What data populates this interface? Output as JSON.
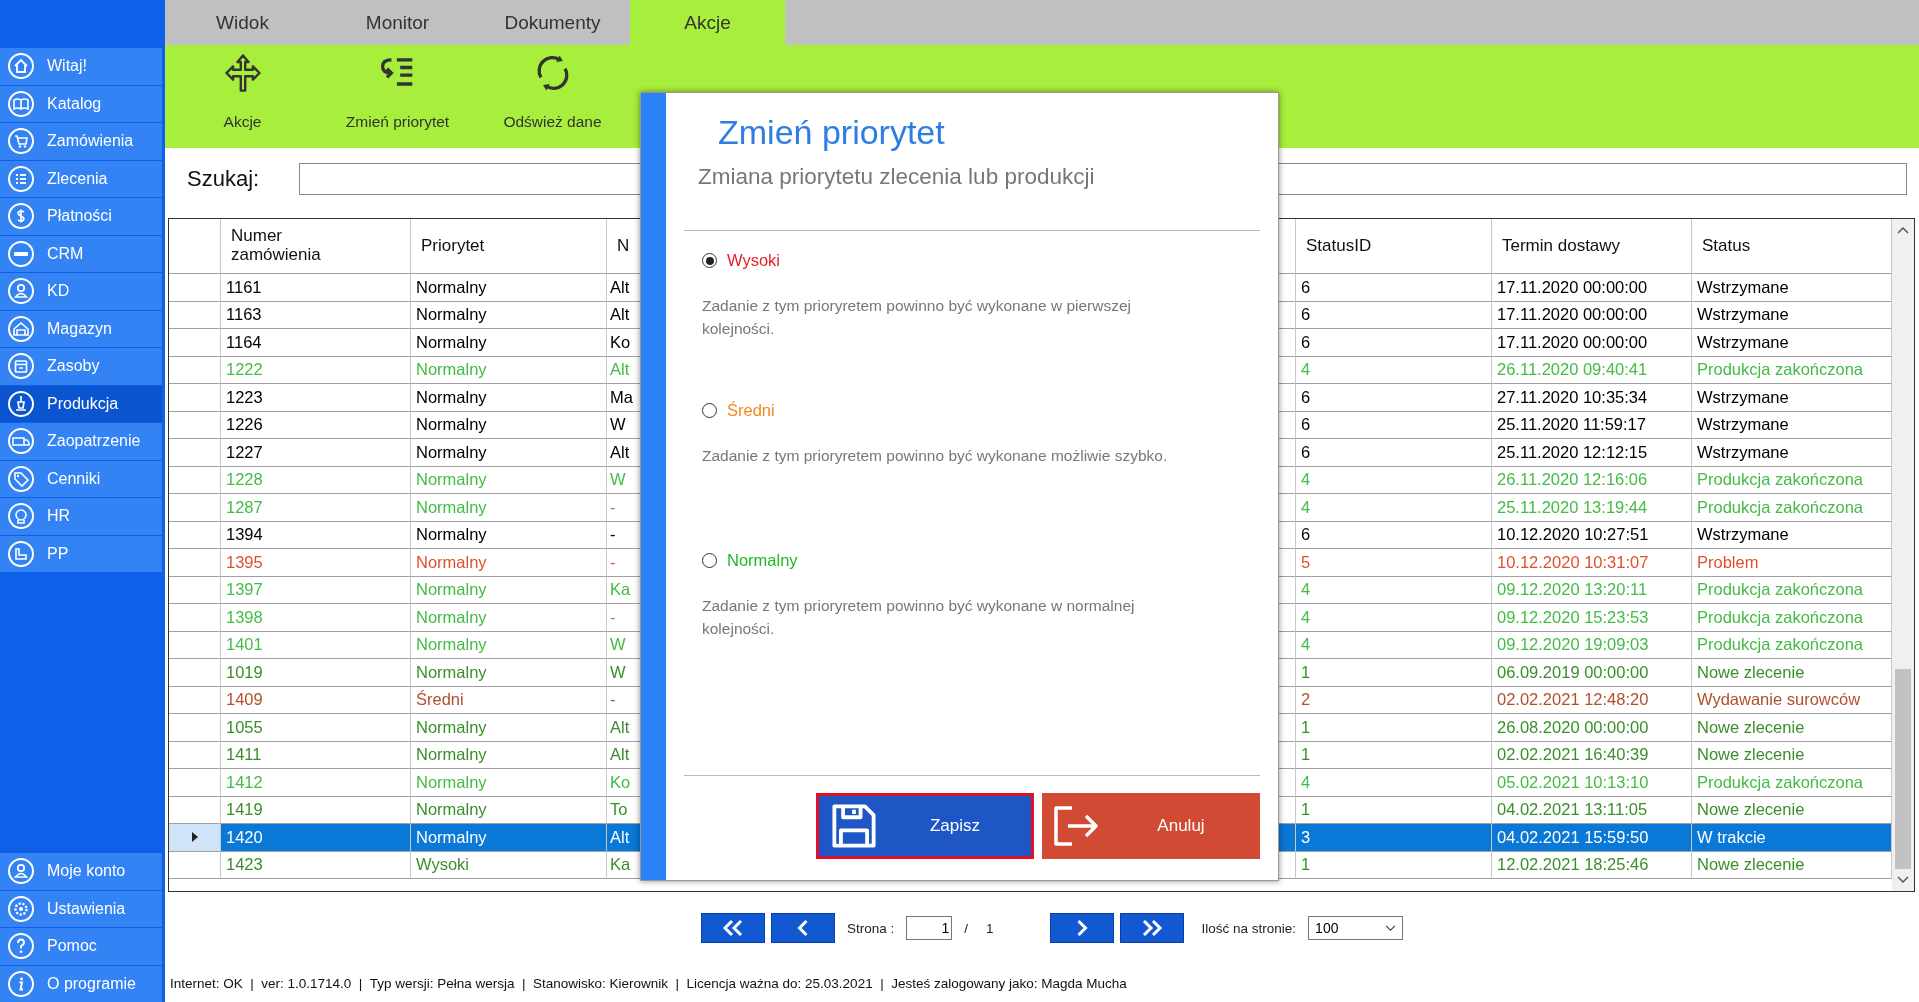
{
  "sidebar": {
    "items": [
      {
        "label": "Witaj!",
        "selected": false
      },
      {
        "label": "Katalog",
        "selected": false
      },
      {
        "label": "Zamówienia",
        "selected": false
      },
      {
        "label": "Zlecenia",
        "selected": false
      },
      {
        "label": "Płatności",
        "selected": false
      },
      {
        "label": "CRM",
        "selected": false
      },
      {
        "label": "KD",
        "selected": false
      },
      {
        "label": "Magazyn",
        "selected": false
      },
      {
        "label": "Zasoby",
        "selected": false
      },
      {
        "label": "Produkcja",
        "selected": true
      },
      {
        "label": "Zaopatrzenie",
        "selected": false
      },
      {
        "label": "Cenniki",
        "selected": false
      },
      {
        "label": "HR",
        "selected": false
      },
      {
        "label": "PP",
        "selected": false
      }
    ],
    "bottom_items": [
      {
        "label": "Moje konto",
        "selected": false
      },
      {
        "label": "Ustawienia",
        "selected": false
      },
      {
        "label": "Pomoc",
        "selected": false
      },
      {
        "label": "O programie",
        "selected": false
      }
    ]
  },
  "tabs": [
    {
      "label": "Widok",
      "selected": false
    },
    {
      "label": "Monitor",
      "selected": false
    },
    {
      "label": "Dokumenty",
      "selected": false
    },
    {
      "label": "Akcje",
      "selected": true
    }
  ],
  "toolbar": {
    "buttons": [
      {
        "label": "Akcje"
      },
      {
        "label": "Zmień priorytet"
      },
      {
        "label": "Odśwież dane"
      }
    ]
  },
  "search": {
    "label": "Szukaj:"
  },
  "table": {
    "columns": [
      "Numer zamówienia",
      "Priorytet",
      "N",
      "StatusID",
      "Termin dostawy",
      "Status"
    ],
    "rows": [
      {
        "cells": [
          "1161",
          "Normalny",
          "Alt",
          "6",
          "17.11.2020 00:00:00",
          "Wstrzymane"
        ],
        "color": "#000000",
        "selected": false
      },
      {
        "cells": [
          "1163",
          "Normalny",
          "Alt",
          "6",
          "17.11.2020 00:00:00",
          "Wstrzymane"
        ],
        "color": "#000000",
        "selected": false
      },
      {
        "cells": [
          "1164",
          "Normalny",
          "Ko",
          "6",
          "17.11.2020 00:00:00",
          "Wstrzymane"
        ],
        "color": "#000000",
        "selected": false
      },
      {
        "cells": [
          "1222",
          "Normalny",
          "Alt",
          "4",
          "26.11.2020 09:40:41",
          "Produkcja zakończona"
        ],
        "color": "#44bb44",
        "selected": false
      },
      {
        "cells": [
          "1223",
          "Normalny",
          "Ma",
          "6",
          "27.11.2020 10:35:34",
          "Wstrzymane"
        ],
        "color": "#000000",
        "selected": false
      },
      {
        "cells": [
          "1226",
          "Normalny",
          "W",
          "6",
          "25.11.2020 11:59:17",
          "Wstrzymane"
        ],
        "color": "#000000",
        "selected": false
      },
      {
        "cells": [
          "1227",
          "Normalny",
          "Alt",
          "6",
          "25.11.2020 12:12:15",
          "Wstrzymane"
        ],
        "color": "#000000",
        "selected": false
      },
      {
        "cells": [
          "1228",
          "Normalny",
          "W",
          "4",
          "26.11.2020 12:16:06",
          "Produkcja zakończona"
        ],
        "color": "#44bb44",
        "selected": false
      },
      {
        "cells": [
          "1287",
          "Normalny",
          "-",
          "4",
          "25.11.2020 13:19:44",
          "Produkcja zakończona"
        ],
        "color": "#44bb44",
        "selected": false
      },
      {
        "cells": [
          "1394",
          "Normalny",
          "-",
          "6",
          "10.12.2020 10:27:51",
          "Wstrzymane"
        ],
        "color": "#000000",
        "selected": false
      },
      {
        "cells": [
          "1395",
          "Normalny",
          "-",
          "5",
          "10.12.2020 10:31:07",
          "Problem"
        ],
        "color": "#e0502e",
        "selected": false
      },
      {
        "cells": [
          "1397",
          "Normalny",
          "Ka",
          "4",
          "09.12.2020 13:20:11",
          "Produkcja zakończona"
        ],
        "color": "#44bb44",
        "selected": false
      },
      {
        "cells": [
          "1398",
          "Normalny",
          "-",
          "4",
          "09.12.2020 15:23:53",
          "Produkcja zakończona"
        ],
        "color": "#44bb44",
        "selected": false
      },
      {
        "cells": [
          "1401",
          "Normalny",
          "W",
          "4",
          "09.12.2020 19:09:03",
          "Produkcja zakończona"
        ],
        "color": "#44bb44",
        "selected": false
      },
      {
        "cells": [
          "1019",
          "Normalny",
          "W",
          "1",
          "06.09.2019 00:00:00",
          "Nowe zlecenie"
        ],
        "color": "#3a8f2a",
        "selected": false
      },
      {
        "cells": [
          "1409",
          "Średni",
          "-",
          "2",
          "02.02.2021 12:48:20",
          "Wydawanie surowców"
        ],
        "color": "#b0502a",
        "selected": false
      },
      {
        "cells": [
          "1055",
          "Normalny",
          "Alt",
          "1",
          "26.08.2020 00:00:00",
          "Nowe zlecenie"
        ],
        "color": "#3a8f2a",
        "selected": false
      },
      {
        "cells": [
          "1411",
          "Normalny",
          "Alt",
          "1",
          "02.02.2021 16:40:39",
          "Nowe zlecenie"
        ],
        "color": "#3a8f2a",
        "selected": false
      },
      {
        "cells": [
          "1412",
          "Normalny",
          "Ko",
          "4",
          "05.02.2021 10:13:10",
          "Produkcja zakończona"
        ],
        "color": "#44bb44",
        "selected": false
      },
      {
        "cells": [
          "1419",
          "Normalny",
          "To",
          "1",
          "04.02.2021 13:11:05",
          "Nowe zlecenie"
        ],
        "color": "#3a8f2a",
        "selected": false
      },
      {
        "cells": [
          "1420",
          "Normalny",
          "Alt",
          "3",
          "04.02.2021 15:59:50",
          "W trakcie"
        ],
        "selected": true
      },
      {
        "cells": [
          "1423",
          "Wysoki",
          "Ka",
          "1",
          "12.02.2021 18:25:46",
          "Nowe zlecenie"
        ],
        "color": "#3a8f2a",
        "selected": false
      }
    ]
  },
  "dialog": {
    "title": "Zmień priorytet",
    "subtitle": "Zmiana priorytetu zlecenia lub produkcji",
    "options": [
      {
        "label": "Wysoki",
        "color": "#e8202a",
        "selected": true,
        "description": "Zadanie z tym prioryretem powinno być wykonane w pierwszej kolejności."
      },
      {
        "label": "Średni",
        "color": "#f08a1c",
        "selected": false,
        "description": "Zadanie z tym prioryretem powinno być wykonane możliwie szybko."
      },
      {
        "label": "Normalny",
        "color": "#22b822",
        "selected": false,
        "description": "Zadanie z tym prioryretem powinno być wykonane w normalnej kolejności."
      }
    ],
    "buttons": [
      {
        "kind": "save",
        "label": "Zapisz",
        "focused": true
      },
      {
        "kind": "cancel",
        "label": "Anuluj",
        "focused": false
      }
    ]
  },
  "pagination": {
    "page_label": "Strona :",
    "page": "1",
    "separator": "/",
    "total": "1",
    "per_page_label": "Ilość na stronie:",
    "per_page": "100"
  },
  "status_bar": {
    "text": "Internet: OK  |  ver: 1.0.1714.0  |  Typ wersji: Pełna wersja  |  Stanowisko: Kierownik  |  Licencja ważna do: 25.03.2021  |  Jesteś zalogowany jako: Magda Mucha"
  }
}
